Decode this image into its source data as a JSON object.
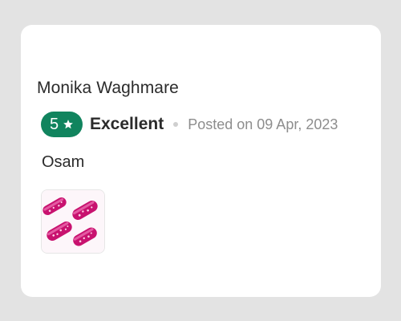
{
  "review": {
    "reviewer_name": "Monika Waghmare",
    "rating_value": "5",
    "rating_word": "Excellent",
    "posted_text": "Posted on 09 Apr, 2023",
    "review_text": "Osam"
  },
  "colors": {
    "page_background": "#e3e3e3",
    "card_background": "#ffffff",
    "badge_green": "#11845e",
    "text_primary": "#2b2b2b",
    "text_muted": "#8d8d8d",
    "product_magenta": "#d1157a"
  },
  "icons": {
    "badge": "star-icon",
    "separator": "dot-separator"
  },
  "attachments": [
    {
      "type": "image",
      "description": "product-photo"
    }
  ]
}
